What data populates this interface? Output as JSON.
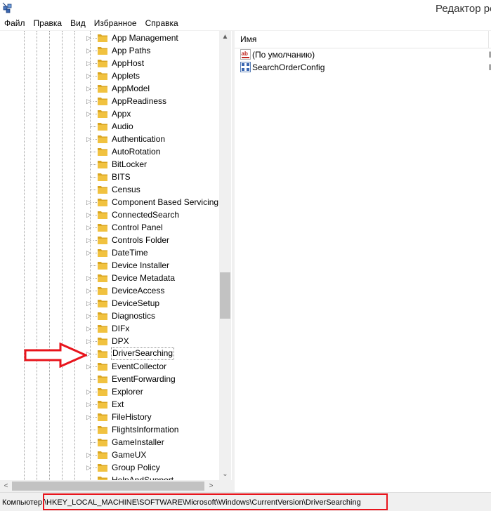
{
  "window": {
    "title": "Редактор ре"
  },
  "menu": {
    "items": [
      "Файл",
      "Правка",
      "Вид",
      "Избранное",
      "Справка"
    ]
  },
  "tree": {
    "selected": "DriverSearching",
    "items": [
      {
        "label": "App Management",
        "expandable": true
      },
      {
        "label": "App Paths",
        "expandable": true
      },
      {
        "label": "AppHost",
        "expandable": true
      },
      {
        "label": "Applets",
        "expandable": true
      },
      {
        "label": "AppModel",
        "expandable": true
      },
      {
        "label": "AppReadiness",
        "expandable": true
      },
      {
        "label": "Appx",
        "expandable": true
      },
      {
        "label": "Audio",
        "expandable": false
      },
      {
        "label": "Authentication",
        "expandable": true
      },
      {
        "label": "AutoRotation",
        "expandable": false
      },
      {
        "label": "BitLocker",
        "expandable": false
      },
      {
        "label": "BITS",
        "expandable": false
      },
      {
        "label": "Census",
        "expandable": false
      },
      {
        "label": "Component Based Servicing",
        "expandable": true
      },
      {
        "label": "ConnectedSearch",
        "expandable": true
      },
      {
        "label": "Control Panel",
        "expandable": true
      },
      {
        "label": "Controls Folder",
        "expandable": true
      },
      {
        "label": "DateTime",
        "expandable": true
      },
      {
        "label": "Device Installer",
        "expandable": false
      },
      {
        "label": "Device Metadata",
        "expandable": true
      },
      {
        "label": "DeviceAccess",
        "expandable": true
      },
      {
        "label": "DeviceSetup",
        "expandable": true
      },
      {
        "label": "Diagnostics",
        "expandable": true
      },
      {
        "label": "DIFx",
        "expandable": true
      },
      {
        "label": "DPX",
        "expandable": true
      },
      {
        "label": "DriverSearching",
        "expandable": true
      },
      {
        "label": "EventCollector",
        "expandable": true
      },
      {
        "label": "EventForwarding",
        "expandable": false
      },
      {
        "label": "Explorer",
        "expandable": true
      },
      {
        "label": "Ext",
        "expandable": true
      },
      {
        "label": "FileHistory",
        "expandable": true
      },
      {
        "label": "FlightsInformation",
        "expandable": false
      },
      {
        "label": "GameInstaller",
        "expandable": false
      },
      {
        "label": "GameUX",
        "expandable": true
      },
      {
        "label": "Group Policy",
        "expandable": true
      },
      {
        "label": "HelpAndSupport",
        "expandable": false
      }
    ]
  },
  "scrollbars": {
    "up_arrow": "▲",
    "down_arrow": "⌄",
    "left_arrow": "<",
    "right_arrow": ">"
  },
  "values": {
    "column_name": "Имя",
    "rows": [
      {
        "name": "(По умолчанию)",
        "icon": "string-value-icon",
        "type_trunc": "I"
      },
      {
        "name": "SearchOrderConfig",
        "icon": "dword-value-icon",
        "type_trunc": "I"
      }
    ]
  },
  "statusbar": {
    "prefix": "Компьютер",
    "path": "\\HKEY_LOCAL_MACHINE\\SOFTWARE\\Microsoft\\Windows\\CurrentVersion\\DriverSearching"
  },
  "colors": {
    "annotation_red": "#e8141c",
    "folder_yellow": "#f1c240"
  }
}
